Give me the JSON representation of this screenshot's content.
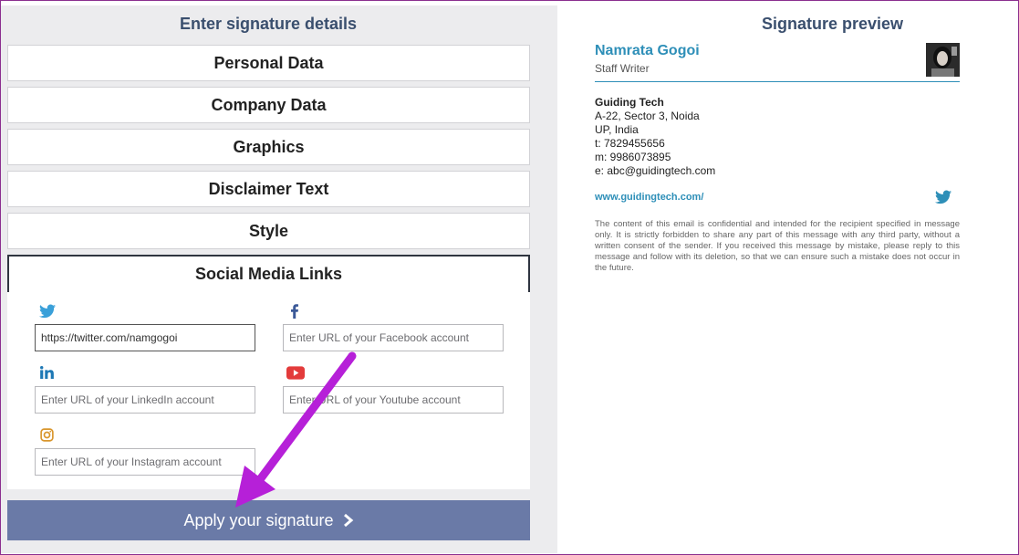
{
  "left_panel": {
    "title": "Enter signature details",
    "sections": [
      {
        "label": "Personal Data"
      },
      {
        "label": "Company Data"
      },
      {
        "label": "Graphics"
      },
      {
        "label": "Disclaimer Text"
      },
      {
        "label": "Style"
      },
      {
        "label": "Social Media Links"
      }
    ],
    "social": {
      "twitter": {
        "icon": "twitter-icon",
        "color": "#3aa0d9",
        "value": "https://twitter.com/namgogoi",
        "placeholder": ""
      },
      "facebook": {
        "icon": "facebook-icon",
        "color": "#3b5998",
        "value": "",
        "placeholder": "Enter URL of your Facebook account"
      },
      "linkedin": {
        "icon": "linkedin-icon",
        "color": "#1d78b5",
        "value": "",
        "placeholder": "Enter URL of your LinkedIn account"
      },
      "youtube": {
        "icon": "youtube-icon",
        "color": "#e33b3b",
        "value": "",
        "placeholder": "Enter URL of your Youtube account"
      },
      "instagram": {
        "icon": "instagram-icon",
        "color": "#d9962d",
        "value": "",
        "placeholder": "Enter URL of your Instagram account"
      }
    },
    "apply_label": "Apply your signature",
    "apply_color": "#6a7aa7"
  },
  "preview": {
    "title": "Signature preview",
    "name": "Namrata Gogoi",
    "job_title": "Staff Writer",
    "company": "Guiding Tech",
    "address1": "A-22, Sector 3, Noida",
    "address2": "UP, India",
    "phone": "t: 7829455656",
    "mobile": "m: 9986073895",
    "email": "e: abc@guidingtech.com",
    "website": "www.guidingtech.com/",
    "disclaimer": "The content of this email is confidential and intended for the recipient specified in message only. It is strictly forbidden to share any part of this message with any third party, without a written consent of the sender. If you received this message by mistake, please reply to this message and follow with its deletion, so that we can ensure such a mistake does not occur in the future.",
    "accent_color": "#2e8fb8"
  },
  "annotation": {
    "arrow_color": "#b620d8"
  }
}
